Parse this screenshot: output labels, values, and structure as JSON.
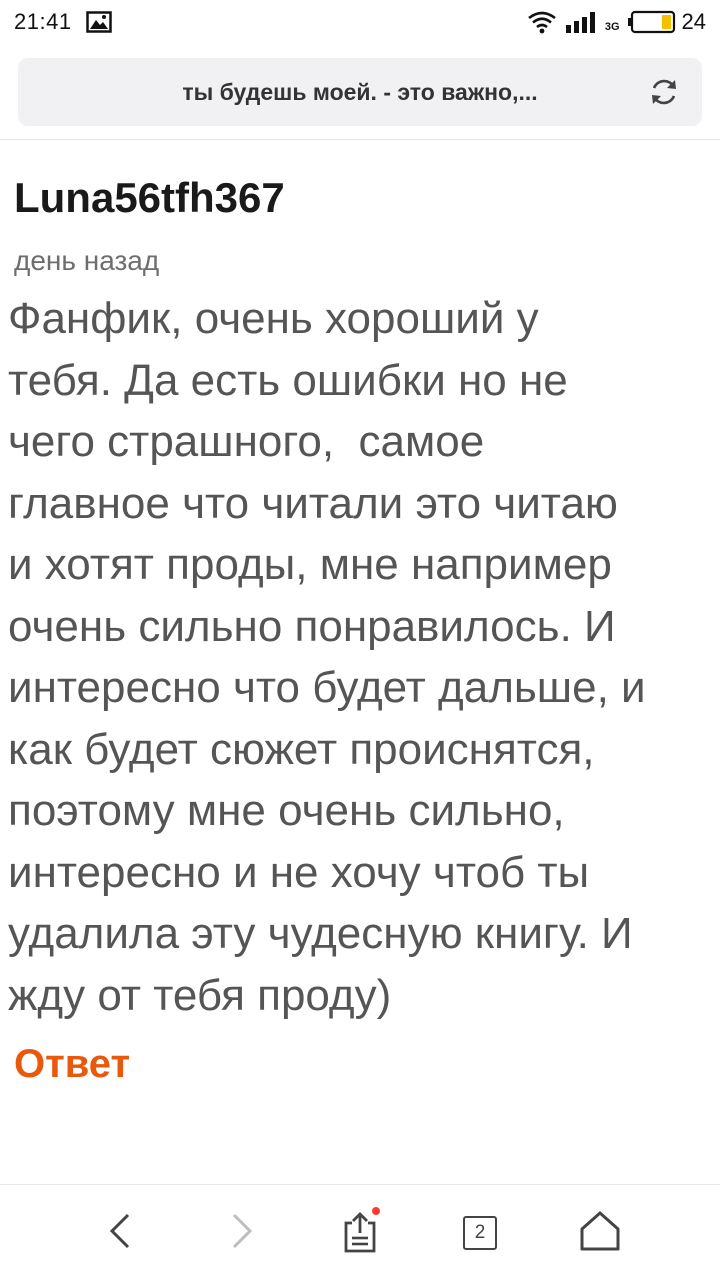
{
  "status_bar": {
    "time": "21:41",
    "network_type": "3G",
    "battery_level": "24",
    "icons": [
      "image-notification-icon",
      "wifi-icon",
      "signal-icon",
      "battery-icon"
    ]
  },
  "address_bar": {
    "title": "ты будешь моей. - это важно,..."
  },
  "comment": {
    "author": "Luna56tfh367",
    "time": "день назад",
    "body": "Фанфик, очень хороший у\nтебя. Да есть ошибки но не\nчего страшного,  самое\nглавное что читали это читаю\nи хотят проды, мне например\nочень сильно понравилось. И\nинтересно что будет дальше, и\nкак будет сюжет происнятся,\nпоэтому мне очень сильно,\nинтересно и не хочу чтоб ты\nудалила эту чудесную книгу. И\nжду от тебя проду)",
    "reply_label": "Ответ"
  },
  "bottom_nav": {
    "tab_count": "2",
    "share_has_badge": true
  },
  "colors": {
    "accent": "#e8590c",
    "badge": "#ff3b30",
    "battery_fill": "#f5c000"
  }
}
